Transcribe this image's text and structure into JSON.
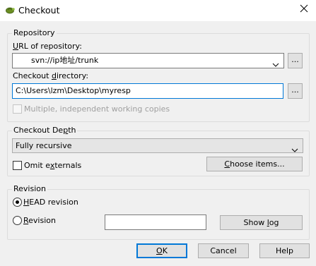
{
  "window": {
    "title": "Checkout",
    "icons": {
      "app": "tortoise-svn-icon",
      "close": "close-icon"
    }
  },
  "repository": {
    "group_label": "Repository",
    "url_label_hotkey": "U",
    "url_label_rest": "RL of repository:",
    "url_value": "svn://ip地址/trunk",
    "url_browse": "...",
    "dir_label_pre": "Checkout ",
    "dir_label_hotkey": "d",
    "dir_label_post": "irectory:",
    "dir_value": "C:\\Users\\lzm\\Desktop\\myresp",
    "dir_browse": "...",
    "multiple_label": "Multiple, independent working copies"
  },
  "depth": {
    "group_label_pre": "Checkout De",
    "group_label_hotkey": "p",
    "group_label_post": "th",
    "selected": "Fully recursive",
    "omit_pre": "Omit e",
    "omit_hotkey": "x",
    "omit_post": "ternals",
    "choose_hotkey": "C",
    "choose_rest": "hoose items..."
  },
  "revision": {
    "group_label": "Revision",
    "head_hotkey": "H",
    "head_rest": "EAD revision",
    "rev_hotkey": "R",
    "rev_rest": "evision",
    "rev_value": "",
    "show_log_pre": "Show ",
    "show_log_hotkey": "l",
    "show_log_post": "og"
  },
  "buttons": {
    "ok_hotkey": "O",
    "ok_rest": "K",
    "cancel": "Cancel",
    "help": "Help"
  }
}
